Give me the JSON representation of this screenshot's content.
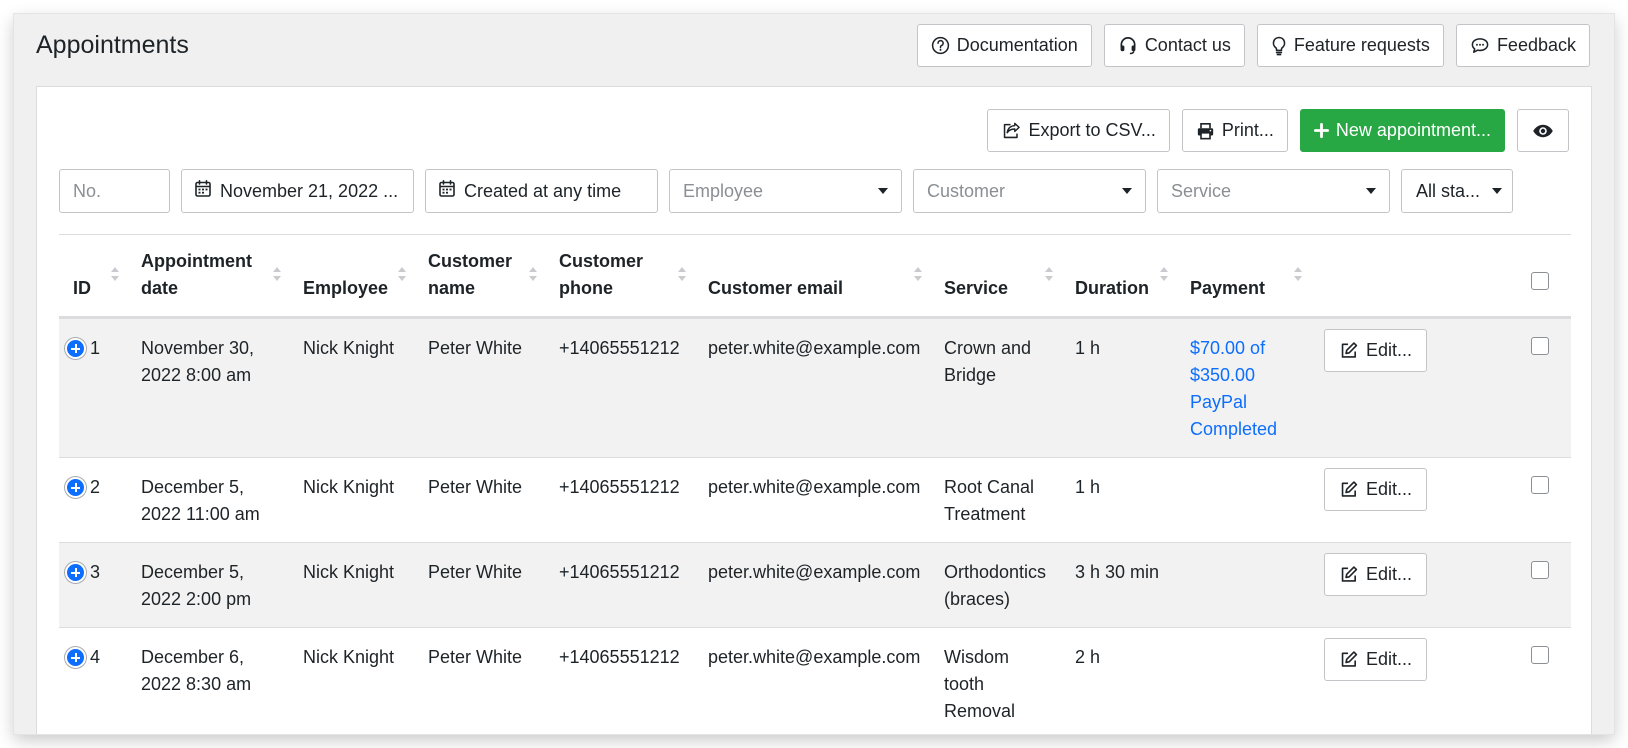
{
  "page": {
    "title": "Appointments"
  },
  "top_buttons": [
    {
      "label": "Documentation",
      "icon": "question-circle-icon"
    },
    {
      "label": "Contact us",
      "icon": "headset-icon"
    },
    {
      "label": "Feature requests",
      "icon": "lightbulb-icon"
    },
    {
      "label": "Feedback",
      "icon": "chat-bubble-icon"
    }
  ],
  "toolbar": {
    "export_label": "Export to CSV...",
    "print_label": "Print...",
    "new_label": "New appointment...",
    "eye_icon": "eye-icon"
  },
  "filters": {
    "number_placeholder": "No.",
    "date_range": "November 21, 2022 ...",
    "created": "Created at any time",
    "employee_placeholder": "Employee",
    "customer_placeholder": "Customer",
    "service_placeholder": "Service",
    "status": "All sta..."
  },
  "table": {
    "headers": {
      "id": "ID",
      "date": "Appointment date",
      "employee": "Employee",
      "customer_name": "Customer name",
      "customer_phone": "Customer phone",
      "customer_email": "Customer email",
      "service": "Service",
      "duration": "Duration",
      "payment": "Payment"
    },
    "edit_label": "Edit...",
    "rows": [
      {
        "id": "1",
        "date": "November 30, 2022 8:00 am",
        "employee": "Nick Knight",
        "customer_name": "Peter White",
        "customer_phone": "+14065551212",
        "customer_email": "peter.white@example.com",
        "service": "Crown and Bridge",
        "duration": "1 h",
        "payment_amount": "$70.00 of $350.00",
        "payment_method": "PayPal",
        "payment_status": "Completed"
      },
      {
        "id": "2",
        "date": "December 5, 2022 11:00 am",
        "employee": "Nick Knight",
        "customer_name": "Peter White",
        "customer_phone": "+14065551212",
        "customer_email": "peter.white@example.com",
        "service": "Root Canal Treatment",
        "duration": "1 h",
        "payment_amount": "",
        "payment_method": "",
        "payment_status": ""
      },
      {
        "id": "3",
        "date": "December 5, 2022 2:00 pm",
        "employee": "Nick Knight",
        "customer_name": "Peter White",
        "customer_phone": "+14065551212",
        "customer_email": "peter.white@example.com",
        "service": "Orthodontics (braces)",
        "duration": "3 h 30 min",
        "payment_amount": "",
        "payment_method": "",
        "payment_status": ""
      },
      {
        "id": "4",
        "date": "December 6, 2022 8:30 am",
        "employee": "Nick Knight",
        "customer_name": "Peter White",
        "customer_phone": "+14065551212",
        "customer_email": "peter.white@example.com",
        "service": "Wisdom tooth Removal",
        "duration": "2 h",
        "payment_amount": "",
        "payment_method": "",
        "payment_status": ""
      }
    ]
  },
  "colors": {
    "accent_blue": "#0d6efd",
    "success_green": "#28a745",
    "page_background": "#f0f0f1"
  }
}
